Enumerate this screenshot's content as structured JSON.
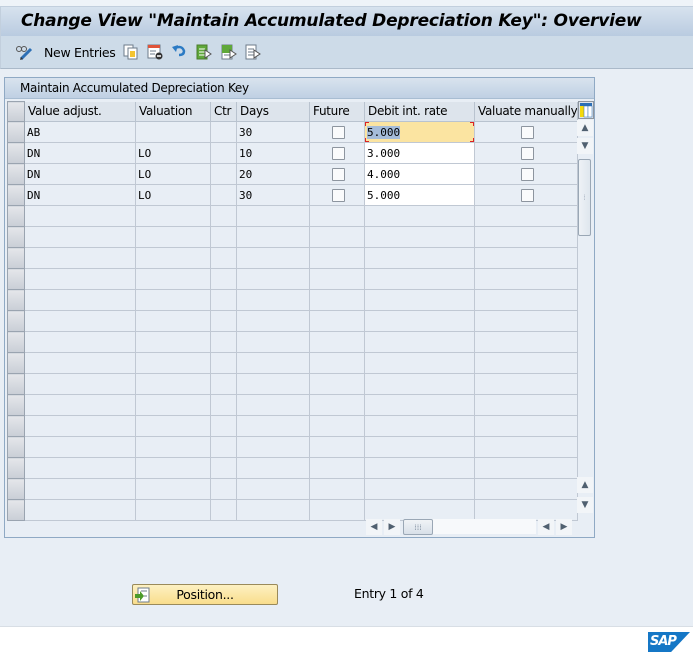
{
  "window": {
    "title": "Change View \"Maintain Accumulated Depreciation Key\": Overview"
  },
  "toolbar": {
    "items": [
      {
        "icon": "display-change-icon"
      },
      {
        "label": "New Entries"
      },
      {
        "icon": "copy-icon"
      },
      {
        "icon": "delete-icon"
      },
      {
        "icon": "undo-icon"
      },
      {
        "icon": "select-all-icon"
      },
      {
        "icon": "select-block-icon"
      },
      {
        "icon": "deselect-all-icon"
      }
    ],
    "new_entries_label": "New Entries"
  },
  "table": {
    "frame_title": "Maintain Accumulated Depreciation Key",
    "columns": [
      "Value adjust.",
      "Valuation",
      "Ctr",
      "Days",
      "Future",
      "Debit int. rate",
      "Valuate manually"
    ],
    "rows": [
      {
        "value_adjust": "AB",
        "valuation": "",
        "ctr": "",
        "days": "30",
        "future": false,
        "debit_int_rate": "5.000",
        "valuate_manually": false,
        "focused": true
      },
      {
        "value_adjust": "DN",
        "valuation": "LO",
        "ctr": "",
        "days": "10",
        "future": false,
        "debit_int_rate": "3.000",
        "valuate_manually": false
      },
      {
        "value_adjust": "DN",
        "valuation": "LO",
        "ctr": "",
        "days": "20",
        "future": false,
        "debit_int_rate": "4.000",
        "valuate_manually": false
      },
      {
        "value_adjust": "DN",
        "valuation": "LO",
        "ctr": "",
        "days": "30",
        "future": false,
        "debit_int_rate": "5.000",
        "valuate_manually": false
      }
    ],
    "empty_rows": 15
  },
  "footer": {
    "position_button": "Position...",
    "entry_text": "Entry 1 of 4"
  },
  "status": {
    "logo": "SAP"
  },
  "colors": {
    "focus_cell": "#fbe4a1",
    "button_yellow": "#f9dd8c",
    "sap_blue": "#1577c6"
  }
}
